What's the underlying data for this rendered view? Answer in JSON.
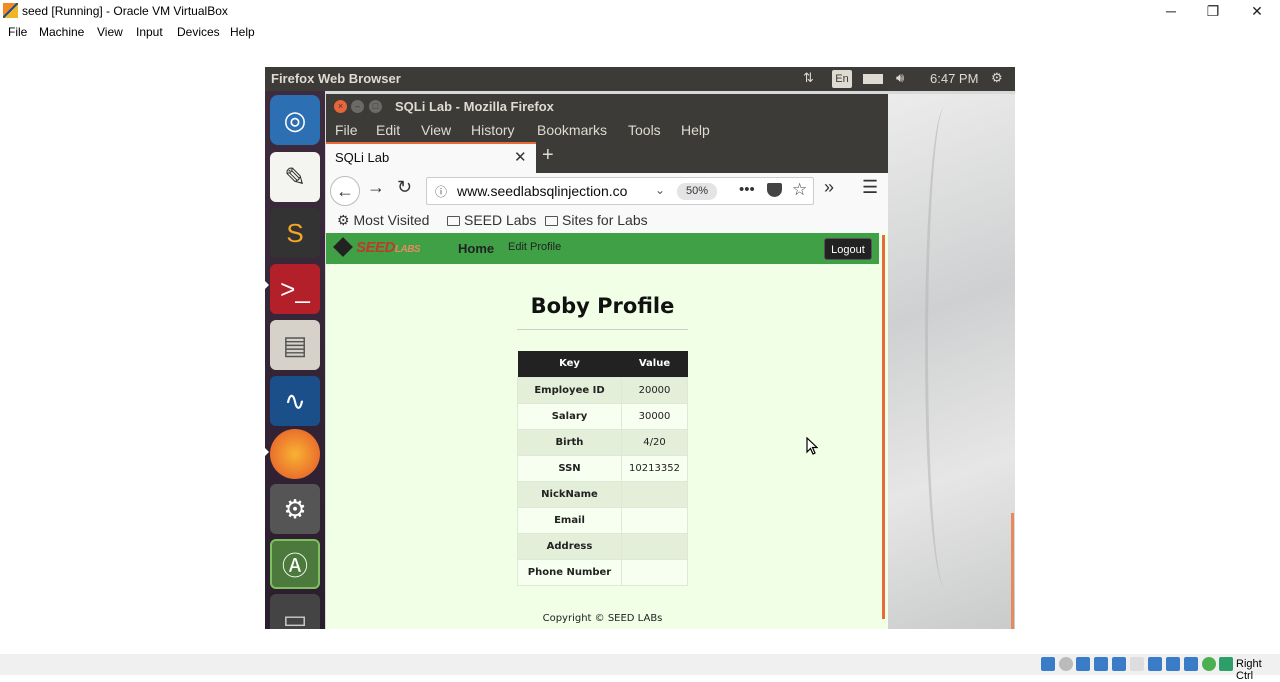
{
  "host": {
    "title": "seed [Running] - Oracle VM VirtualBox",
    "menu": [
      "File",
      "Machine",
      "View",
      "Input",
      "Devices",
      "Help"
    ],
    "controls": {
      "minimize": "─",
      "restore": "❐",
      "close": "✕"
    },
    "status_host_key": "Right Ctrl"
  },
  "guest_panel": {
    "title": "Firefox Web Browser",
    "language": "En",
    "time": "6:47 PM"
  },
  "launcher": {
    "items": [
      "ubuntu-dash-icon",
      "text-editor-icon",
      "sublime-text-icon",
      "terminal-icon",
      "files-icon",
      "wireshark-icon",
      "firefox-icon",
      "settings-icon",
      "software-updater-icon",
      "trash-icon"
    ]
  },
  "firefox": {
    "window_title": "SQLi Lab - Mozilla Firefox",
    "menu": [
      "File",
      "Edit",
      "View",
      "History",
      "Bookmarks",
      "Tools",
      "Help"
    ],
    "tab_title": "SQLi Lab",
    "new_tab_glyph": "+",
    "url_domain": "www.seedlabsqlinjection.co",
    "zoom": "50%",
    "bookmarks": [
      "Most Visited",
      "SEED Labs",
      "Sites for Labs"
    ]
  },
  "site": {
    "logo_main": "SEED",
    "logo_sub": "LABS",
    "nav_home": "Home",
    "nav_edit": "Edit Profile",
    "logout": "Logout",
    "profile_title": "Boby Profile",
    "table_headers": [
      "Key",
      "Value"
    ],
    "rows": [
      {
        "key": "Employee ID",
        "value": "20000"
      },
      {
        "key": "Salary",
        "value": "30000"
      },
      {
        "key": "Birth",
        "value": "4/20"
      },
      {
        "key": "SSN",
        "value": "10213352"
      },
      {
        "key": "NickName",
        "value": ""
      },
      {
        "key": "Email",
        "value": ""
      },
      {
        "key": "Address",
        "value": ""
      },
      {
        "key": "Phone Number",
        "value": ""
      }
    ],
    "copyright": "Copyright © SEED LABs"
  },
  "colors": {
    "ubuntu_panel": "#3c3b37",
    "site_green": "#3fa046",
    "page_bg": "#f0ffe6",
    "accent_orange": "#e66a3a"
  }
}
